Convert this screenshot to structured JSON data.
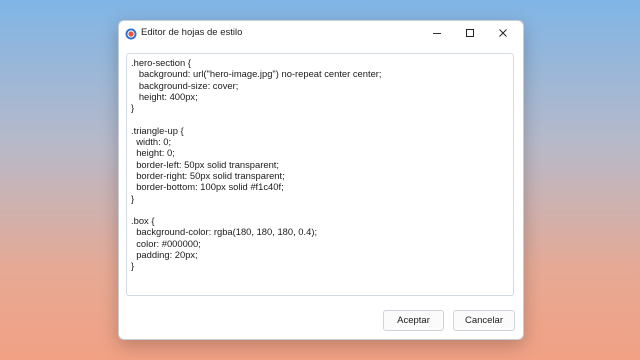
{
  "dialog": {
    "title": "Editor de hojas de estilo",
    "controls": {
      "minimize_icon": "minimize-icon",
      "maximize_icon": "maximize-icon",
      "close_icon": "close-icon"
    }
  },
  "editor": {
    "lines": [
      ".hero-section {",
      "   background: url(\"hero-image.jpg\") no-repeat center center;",
      "   background-size: cover;",
      "   height: 400px;",
      "}",
      "",
      ".triangle-up {",
      "  width: 0;",
      "  height: 0;",
      "  border-left: 50px solid transparent;",
      "  border-right: 50px solid transparent;",
      "  border-bottom: 100px solid #f1c40f;",
      "}",
      "",
      ".box {",
      "  background-color: rgba(180, 180, 180, 0.4);",
      "  color: #000000;",
      "  padding: 20px;",
      "}"
    ]
  },
  "buttons": {
    "accept": "Aceptar",
    "cancel": "Cancelar"
  },
  "colors": {
    "window_bg": "#ffffff",
    "editor_border": "#d3dbe3",
    "button_border": "#cfd4da"
  }
}
